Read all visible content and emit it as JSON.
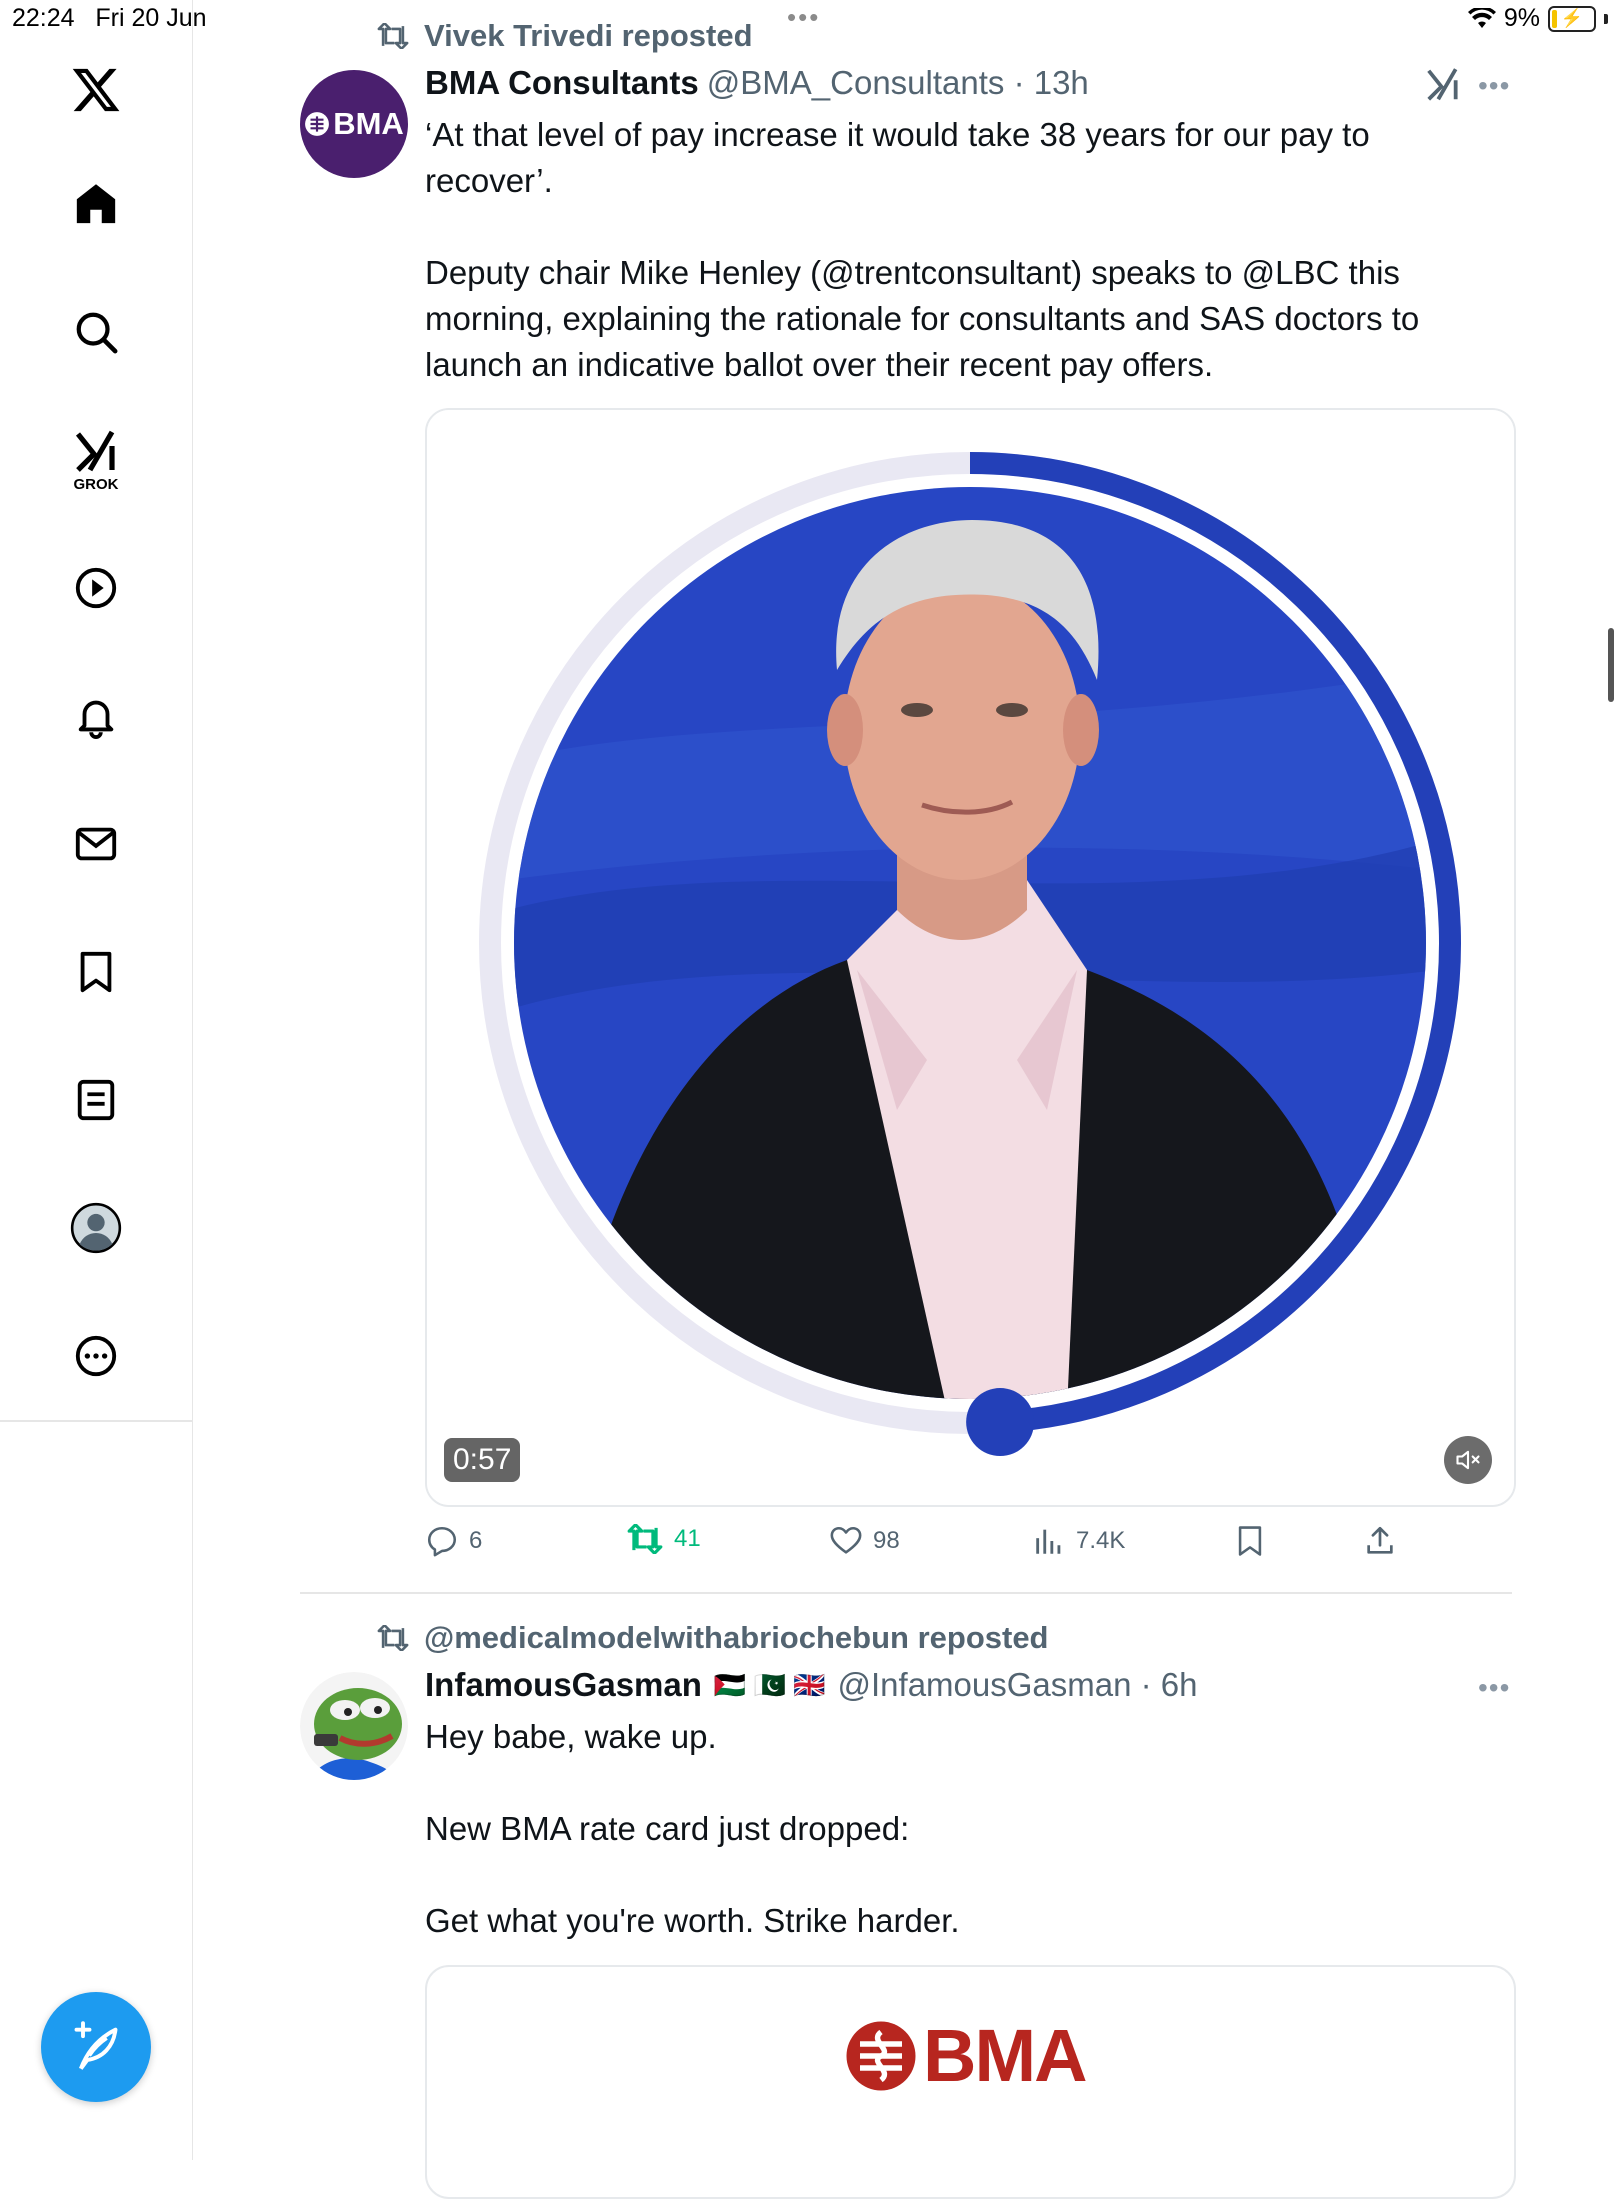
{
  "status_bar": {
    "time": "22:24",
    "date": "Fri 20 Jun",
    "battery": "9%"
  },
  "sidebar": {
    "items": [
      "x-logo",
      "home",
      "search",
      "grok",
      "videos",
      "notifications",
      "messages",
      "bookmarks",
      "lists",
      "profile",
      "more"
    ],
    "grok_label": "GROK"
  },
  "tweet1": {
    "reposted_by": "Vivek Trivedi reposted",
    "avatar_text": "BMA",
    "display_name": "BMA Consultants",
    "handle_time": "@BMA_Consultants · 13h",
    "text": "‘At that level of pay increase it would take 38 years for our pay to recover’.\n\nDeputy chair Mike Henley (@trentconsultant) speaks to @LBC this morning, explaining the rationale for consultants and SAS doctors to launch an indicative ballot over their recent pay offers.",
    "video": {
      "duration": "0:57",
      "progress": 0.49
    },
    "actions": {
      "replies": "6",
      "reposts": "41",
      "likes": "98",
      "views": "7.4K"
    }
  },
  "tweet2": {
    "reposted_by": "@medicalmodelwithabriochebun reposted",
    "display_name": "InfamousGasman",
    "flags": "🇵🇸 🇵🇰 🇬🇧",
    "handle_time": "@InfamousGasman · 6h",
    "text": "Hey babe, wake up.\n\nNew BMA rate card just dropped:\n\nGet what you're worth. Strike harder.",
    "card_logo_text": "BMA"
  },
  "colors": {
    "accent": "#1d9bf0",
    "bma_purple": "#4a1f6e",
    "bma_red": "#b7261f",
    "repost_green": "#00ba7c",
    "video_ring": "#233fb8"
  }
}
